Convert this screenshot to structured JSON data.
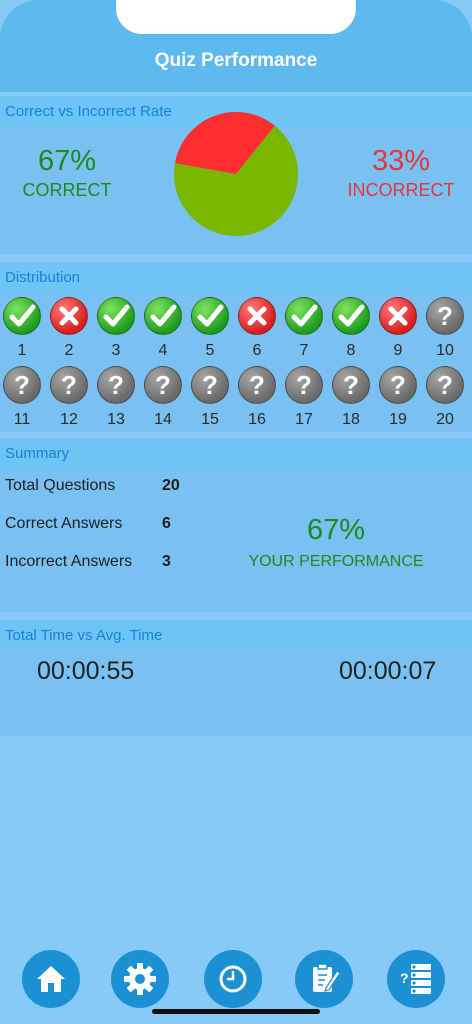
{
  "header": {
    "title": "Quiz Performance"
  },
  "rate": {
    "heading": "Correct vs Incorrect Rate",
    "correct_pct": "67%",
    "correct_label": "CORRECT",
    "incorrect_pct": "33%",
    "incorrect_label": "INCORRECT",
    "correct_fraction": 0.67,
    "correct_color": "#7ab800",
    "incorrect_color": "#ff2e2e"
  },
  "distribution": {
    "heading": "Distribution",
    "items": [
      {
        "num": "1",
        "status": "correct"
      },
      {
        "num": "2",
        "status": "incorrect"
      },
      {
        "num": "3",
        "status": "correct"
      },
      {
        "num": "4",
        "status": "correct"
      },
      {
        "num": "5",
        "status": "correct"
      },
      {
        "num": "6",
        "status": "incorrect"
      },
      {
        "num": "7",
        "status": "correct"
      },
      {
        "num": "8",
        "status": "correct"
      },
      {
        "num": "9",
        "status": "incorrect"
      },
      {
        "num": "10",
        "status": "unanswered"
      },
      {
        "num": "11",
        "status": "unanswered"
      },
      {
        "num": "12",
        "status": "unanswered"
      },
      {
        "num": "13",
        "status": "unanswered"
      },
      {
        "num": "14",
        "status": "unanswered"
      },
      {
        "num": "15",
        "status": "unanswered"
      },
      {
        "num": "16",
        "status": "unanswered"
      },
      {
        "num": "17",
        "status": "unanswered"
      },
      {
        "num": "18",
        "status": "unanswered"
      },
      {
        "num": "19",
        "status": "unanswered"
      },
      {
        "num": "20",
        "status": "unanswered"
      }
    ]
  },
  "summary": {
    "heading": "Summary",
    "total_label": "Total Questions",
    "total_value": "20",
    "correct_label": "Correct Answers",
    "correct_value": "6",
    "incorrect_label": "Incorrect Answers",
    "incorrect_value": "3",
    "performance_pct": "67%",
    "performance_label": "YOUR PERFORMANCE"
  },
  "time": {
    "heading": "Total Time vs Avg. Time",
    "total_time": "00:00:55",
    "avg_time": "00:00:07"
  },
  "toolbar": {
    "icons": [
      "home-icon",
      "gear-icon",
      "clock-icon",
      "edit-notes-icon",
      "question-list-icon"
    ]
  }
}
